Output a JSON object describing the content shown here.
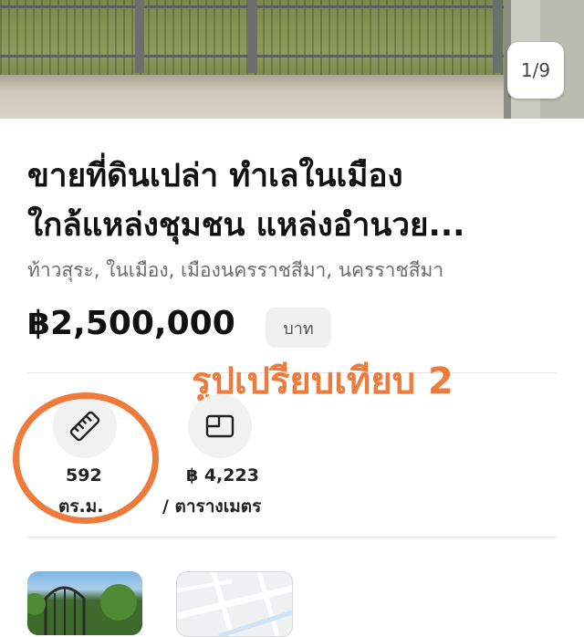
{
  "gallery": {
    "counter": "1/9"
  },
  "listing": {
    "title_line1": "ขายที่ดินเปล่า ทำเลในเมือง",
    "title_line2": "ใกล้แหล่งชุมชน แหล่งอำนวย...",
    "location": "ท้าวสุระ, ในเมือง, เมืองนครราชสีมา, นครราชสีมา",
    "price": "฿2,500,000",
    "price_unit": "บาท"
  },
  "annotation": {
    "text": "รูปเปรียบเทียบ 2",
    "color": "#ee7a3b"
  },
  "stats": {
    "area": {
      "icon": "ruler-icon",
      "value": "592",
      "unit": "ตร.ม."
    },
    "price_per_area": {
      "icon": "area-size-icon",
      "value": "฿ 4,223",
      "unit": "/ ตารางเมตร"
    }
  },
  "thumbnails": [
    {
      "icon": "photo-thumbnail"
    },
    {
      "icon": "map-thumbnail"
    }
  ]
}
